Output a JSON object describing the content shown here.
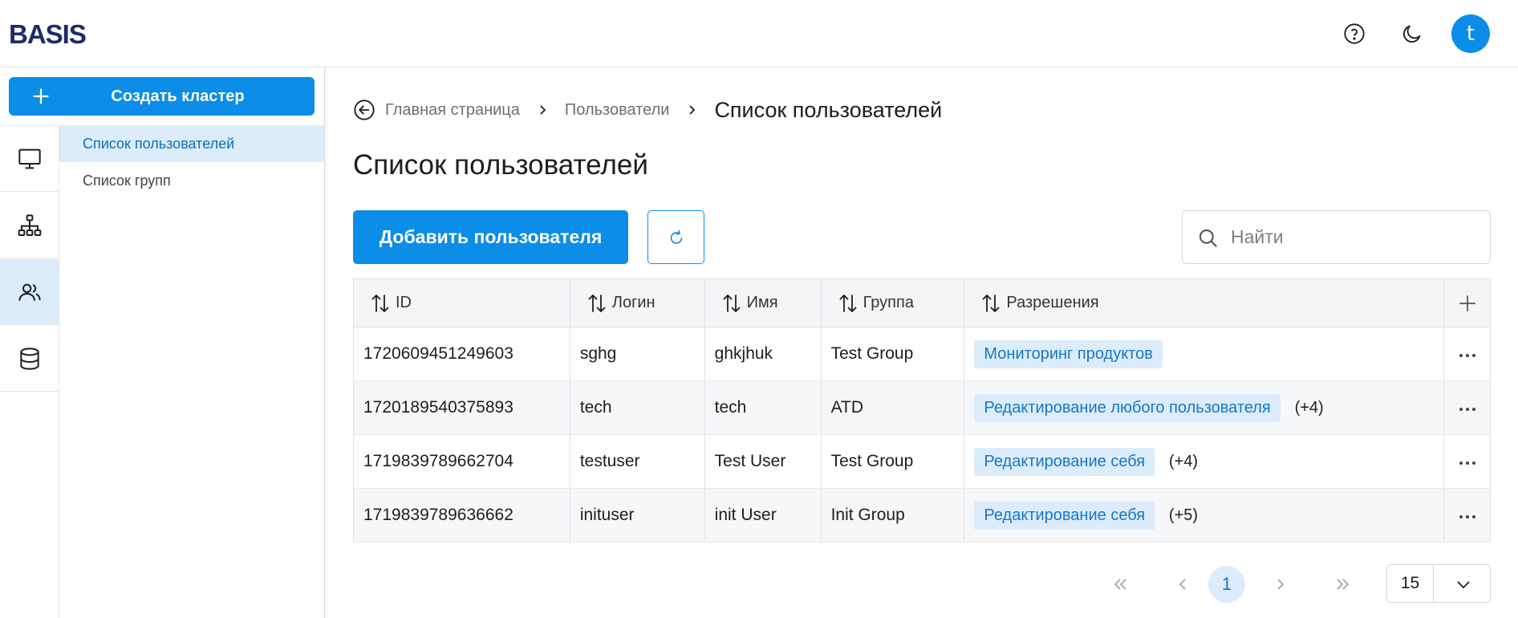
{
  "header": {
    "logo_text": "BASIS",
    "user_initial": "t"
  },
  "sidebar": {
    "create_button": "Создать кластер",
    "rail": [
      "monitor-icon",
      "hierarchy-icon",
      "users-icon",
      "database-icon"
    ],
    "subnav": [
      {
        "label": "Список пользователей",
        "active": true
      },
      {
        "label": "Список групп",
        "active": false
      }
    ]
  },
  "breadcrumb": {
    "items": [
      "Главная страница",
      "Пользователи"
    ],
    "current": "Список пользователей"
  },
  "page": {
    "title": "Список пользователей",
    "add_button": "Добавить пользователя",
    "search_placeholder": "Найти"
  },
  "table": {
    "columns": [
      "ID",
      "Логин",
      "Имя",
      "Группа",
      "Разрешения"
    ],
    "rows": [
      {
        "id": "1720609451249603",
        "login": "sghg",
        "name": "ghkjhuk",
        "group": "Test Group",
        "permission": "Мониторинг продуктов",
        "extra": ""
      },
      {
        "id": "1720189540375893",
        "login": "tech",
        "name": "tech",
        "group": "ATD",
        "permission": "Редактирование любого пользователя",
        "extra": "(+4)"
      },
      {
        "id": "1719839789662704",
        "login": "testuser",
        "name": "Test User",
        "group": "Test Group",
        "permission": "Редактирование себя",
        "extra": "(+4)"
      },
      {
        "id": "1719839789636662",
        "login": "inituser",
        "name": "init User",
        "group": "Init Group",
        "permission": "Редактирование себя",
        "extra": "(+5)"
      }
    ]
  },
  "pagination": {
    "current_page": "1",
    "page_size": "15"
  },
  "colors": {
    "accent": "#0b8de8",
    "accent_light": "#dcecfb",
    "tag_text": "#1677c8"
  }
}
